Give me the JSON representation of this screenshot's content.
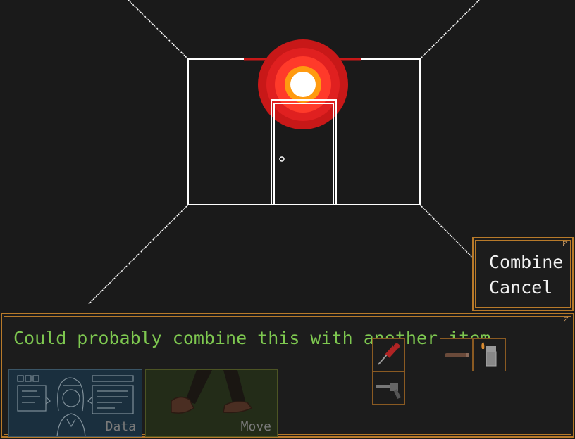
{
  "room": {
    "light_colors": [
      "#c81818",
      "#e02020",
      "#ff3a2a",
      "#ff9a10",
      "#ffffff"
    ]
  },
  "popup_menu": {
    "items": [
      {
        "label": "Combine"
      },
      {
        "label": "Cancel"
      }
    ]
  },
  "dialog": {
    "message": "Could probably combine this with another item."
  },
  "action_buttons": {
    "data_label": "Data",
    "move_label": "Move"
  },
  "inventory": {
    "items": [
      {
        "name": "syringe-icon"
      },
      {
        "name": "revolver-icon"
      },
      {
        "name": "cigar-icon"
      },
      {
        "name": "lighter-icon"
      }
    ]
  }
}
